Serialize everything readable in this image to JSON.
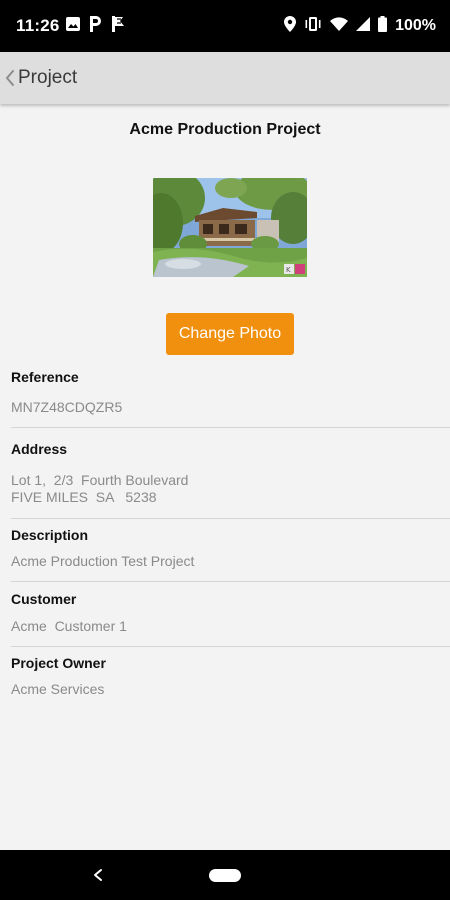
{
  "status_bar": {
    "time": "11:26",
    "battery": "100%",
    "icons": [
      "image-icon",
      "parking-icon",
      "flag-icon",
      "location-icon",
      "vibrate-icon",
      "wifi-icon",
      "signal-icon",
      "battery-icon"
    ]
  },
  "app_bar": {
    "title": "Project",
    "back_icon": "chevron-left-icon"
  },
  "project": {
    "title": "Acme Production Project",
    "photo_alt": "project-photo",
    "change_photo_label": "Change Photo"
  },
  "fields": {
    "reference": {
      "label": "Reference",
      "value": "MN7Z48CDQZR5"
    },
    "address": {
      "label": "Address",
      "line1": "Lot 1,  2/3  Fourth Boulevard",
      "line2": "FIVE MILES  SA   5238"
    },
    "description": {
      "label": "Description",
      "value": "Acme Production Test Project"
    },
    "customer": {
      "label": "Customer",
      "value": "Acme  Customer 1"
    },
    "owner": {
      "label": "Project Owner",
      "value": "Acme Services"
    }
  },
  "nav_bar": {
    "back_icon": "back-triangle-icon",
    "home_icon": "home-pill-icon"
  },
  "colors": {
    "accent": "#f0900e",
    "app_bar": "#dedede",
    "background": "#f3f3f3",
    "value_text": "#8a8a8a"
  }
}
